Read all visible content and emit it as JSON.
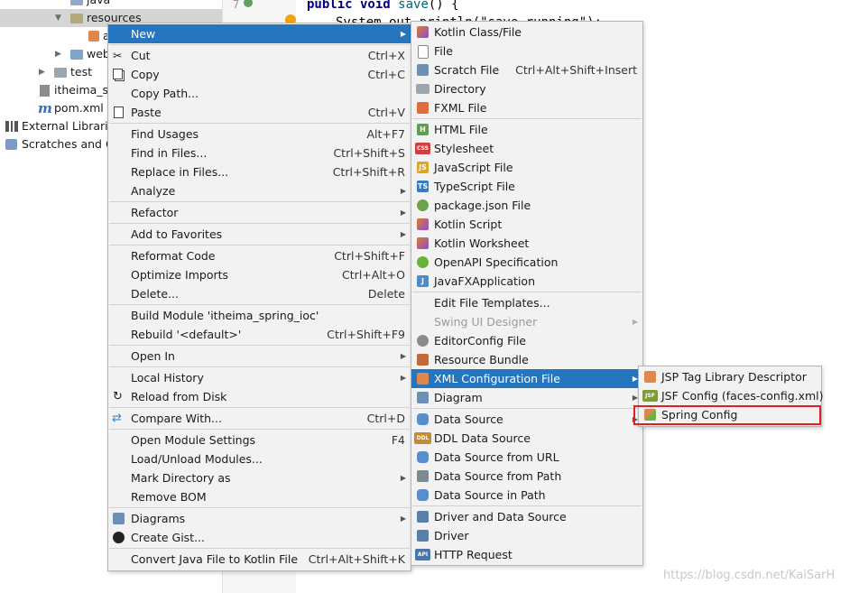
{
  "tree": {
    "items": [
      {
        "label": "java"
      },
      {
        "label": "resources"
      },
      {
        "label": "a"
      },
      {
        "label": "web"
      },
      {
        "label": "test"
      },
      {
        "label": "itheima_sp"
      },
      {
        "label": "pom.xml",
        "icon_text": "m"
      },
      {
        "label": "External Librarie"
      },
      {
        "label": "Scratches and Co"
      }
    ]
  },
  "editor": {
    "line_number": "7",
    "code_keyword": "public void",
    "code_fn": "save",
    "code_rest": "() {",
    "code_line2": "System.out.println(\"save running\");"
  },
  "context_menu": {
    "items": [
      {
        "label": "New"
      },
      {
        "label": "Cut",
        "shortcut": "Ctrl+X"
      },
      {
        "label": "Copy",
        "shortcut": "Ctrl+C"
      },
      {
        "label": "Copy Path..."
      },
      {
        "label": "Paste",
        "shortcut": "Ctrl+V"
      },
      {
        "label": "Find Usages",
        "shortcut": "Alt+F7"
      },
      {
        "label": "Find in Files...",
        "shortcut": "Ctrl+Shift+S"
      },
      {
        "label": "Replace in Files...",
        "shortcut": "Ctrl+Shift+R"
      },
      {
        "label": "Analyze"
      },
      {
        "label": "Refactor"
      },
      {
        "label": "Add to Favorites"
      },
      {
        "label": "Reformat Code",
        "shortcut": "Ctrl+Shift+F"
      },
      {
        "label": "Optimize Imports",
        "shortcut": "Ctrl+Alt+O"
      },
      {
        "label": "Delete...",
        "shortcut": "Delete"
      },
      {
        "label": "Build Module 'itheima_spring_ioc'"
      },
      {
        "label": "Rebuild '<default>'",
        "shortcut": "Ctrl+Shift+F9"
      },
      {
        "label": "Open In"
      },
      {
        "label": "Local History"
      },
      {
        "label": "Reload from Disk"
      },
      {
        "label": "Compare With...",
        "shortcut": "Ctrl+D"
      },
      {
        "label": "Open Module Settings",
        "shortcut": "F4"
      },
      {
        "label": "Load/Unload Modules..."
      },
      {
        "label": "Mark Directory as"
      },
      {
        "label": "Remove BOM"
      },
      {
        "label": "Diagrams"
      },
      {
        "label": "Create Gist..."
      },
      {
        "label": "Convert Java File to Kotlin File",
        "shortcut": "Ctrl+Alt+Shift+K"
      }
    ]
  },
  "new_menu": {
    "items": [
      {
        "label": "Kotlin Class/File"
      },
      {
        "label": "File"
      },
      {
        "label": "Scratch File",
        "shortcut": "Ctrl+Alt+Shift+Insert"
      },
      {
        "label": "Directory"
      },
      {
        "label": "FXML File"
      },
      {
        "label": "HTML File",
        "icon_text": "H"
      },
      {
        "label": "Stylesheet",
        "icon_text": "CSS"
      },
      {
        "label": "JavaScript File",
        "icon_text": "JS"
      },
      {
        "label": "TypeScript File",
        "icon_text": "TS"
      },
      {
        "label": "package.json File"
      },
      {
        "label": "Kotlin Script"
      },
      {
        "label": "Kotlin Worksheet"
      },
      {
        "label": "OpenAPI Specification"
      },
      {
        "label": "JavaFXApplication",
        "icon_text": "J"
      },
      {
        "label": "Edit File Templates..."
      },
      {
        "label": "Swing UI Designer"
      },
      {
        "label": "EditorConfig File"
      },
      {
        "label": "Resource Bundle"
      },
      {
        "label": "XML Configuration File"
      },
      {
        "label": "Diagram"
      },
      {
        "label": "Data Source"
      },
      {
        "label": "DDL Data Source",
        "icon_text": "DDL"
      },
      {
        "label": "Data Source from URL"
      },
      {
        "label": "Data Source from Path"
      },
      {
        "label": "Data Source in Path"
      },
      {
        "label": "Driver and Data Source"
      },
      {
        "label": "Driver"
      },
      {
        "label": "HTTP Request",
        "icon_text": "API"
      }
    ]
  },
  "xml_menu": {
    "items": [
      {
        "label": "JSP Tag Library Descriptor"
      },
      {
        "label": "JSF Config (faces-config.xml)",
        "icon_text": "JSF"
      },
      {
        "label": "Spring Config"
      }
    ]
  },
  "watermark": "https://blog.csdn.net/KaiSarH",
  "colors": {
    "highlight": "#2675bf",
    "menu_bg": "#f2f2f2",
    "annotation_box": "#e02020"
  }
}
